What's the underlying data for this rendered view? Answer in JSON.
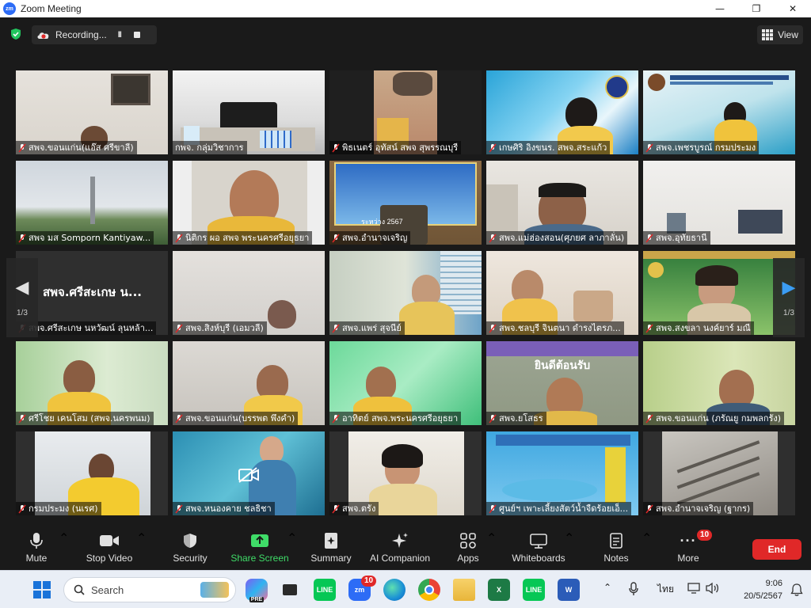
{
  "window": {
    "title": "Zoom Meeting",
    "logo_text": "zm"
  },
  "recording": {
    "label": "Recording...",
    "pause_glyph": "II"
  },
  "view": {
    "label": "View"
  },
  "gallery": {
    "page_indicator_left": "1/3",
    "page_indicator_right": "1/3",
    "active_speaker_text": "สพจ.ศรีสะเกษ น...",
    "participants": [
      {
        "name": "สพจ.ขอนแก่น(แอ๊ส ศรีขาลี)",
        "muted": true
      },
      {
        "name": "กพจ. กลุ่มวิชาการ",
        "muted": false,
        "active": true
      },
      {
        "name": "พิธเนตร์ อุทัสน์ สพจ สุพรรณบุรี",
        "muted": true
      },
      {
        "name": "เกษศิริ อิงขนร. สพจ.สระแก้ว",
        "muted": true
      },
      {
        "name": "สพจ.เพชรบูรณ์ กรมประมง",
        "muted": true
      },
      {
        "name": "สพจ มส Somporn Kantiyaw...",
        "muted": true
      },
      {
        "name": "นิติกร ผอ สพจ พระนครศรีอยุธยา",
        "muted": true
      },
      {
        "name": "สพจ.อำนาจเจริญ",
        "muted": true
      },
      {
        "name": "สพจ.แม่ฮ่องสอน(ศุภยศ ลาภาลั่น)",
        "muted": true
      },
      {
        "name": "สพจ.อุทัยธานี",
        "muted": true
      },
      {
        "name": "สพจ.ศรีสะเกษ นหวัฒน์ ลุนหล้า...",
        "muted": true
      },
      {
        "name": "สพจ.สิงห์บุรี (เอมวลี)",
        "muted": true
      },
      {
        "name": "สพจ.แพร่ สุจนีย์",
        "muted": true
      },
      {
        "name": "สพจ.ชลบุรี จินตนา ดำรงไตรภ...",
        "muted": true
      },
      {
        "name": "สพจ.สงขลา นงค์ยาร์ มณี",
        "muted": true
      },
      {
        "name": "ศรีโชย เคนโสม (สพจ.นครพนม)",
        "muted": true
      },
      {
        "name": "สพจ.ขอนแก่น(บรรพต พึงคำ)",
        "muted": true
      },
      {
        "name": "อาทิตย์ สพจ.พระนครศรีอยุธยา",
        "muted": true
      },
      {
        "name": "สพจ.ยโสธร",
        "muted": true
      },
      {
        "name": "สพจ.ขอนแก่น (ภรัณยู กมพลกรัง)",
        "muted": true
      },
      {
        "name": "กรมประมง (นเรศ)",
        "muted": true
      },
      {
        "name": "สพจ.หนองคาย ชลธิชา",
        "muted": true
      },
      {
        "name": "สพจ.ตรัง",
        "muted": true
      },
      {
        "name": "ศูนย์ฯ เพาะเลี้ยงสัตว์น้ำจืดร้อยเอ็...",
        "muted": true
      },
      {
        "name": "สพจ.อำนาจเจริญ (ฐากร)",
        "muted": true
      }
    ],
    "banner_texts": {
      "tile8": "ระหว่าง 2567",
      "tile19": "ยินดีต้อนรับ"
    }
  },
  "toolbar": {
    "mute": "Mute",
    "stop_video": "Stop Video",
    "security": "Security",
    "share_screen": "Share Screen",
    "summary": "Summary",
    "ai_companion": "AI Companion",
    "apps": "Apps",
    "whiteboards": "Whiteboards",
    "notes": "Notes",
    "more": "More",
    "more_badge": "10",
    "end": "End"
  },
  "taskbar": {
    "search_label": "Search",
    "zoom_badge": "10",
    "language": "ไทย",
    "time": "9:06",
    "date": "20/5/2567",
    "copilot_tag": "PRE"
  },
  "colors": {
    "accent_green": "#3fdc68",
    "end_red": "#e02828",
    "active_border": "#c9e24a",
    "zoom_blue": "#2d6cf6"
  }
}
